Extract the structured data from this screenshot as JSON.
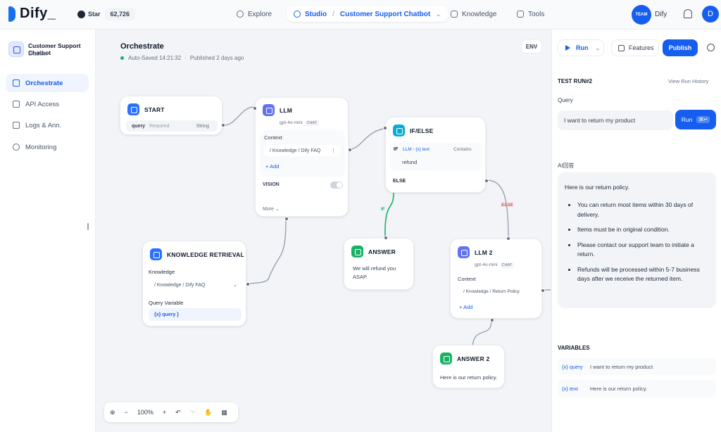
{
  "topbar": {
    "logo": "Dify_",
    "star_label": "Star",
    "star_count": "62,726",
    "nav": {
      "explore": "Explore",
      "studio": "Studio",
      "app_name": "Customer Support Chatbot",
      "knowledge": "Knowledge",
      "tools": "Tools"
    },
    "team_badge": "TEAM",
    "team_name": "Dify",
    "user_initial": "D"
  },
  "sidebar": {
    "app_name": "Customer Support Chatbot",
    "app_type": "Chatflow",
    "items": [
      {
        "label": "Orchestrate",
        "icon": "document-icon",
        "active": true
      },
      {
        "label": "API Access",
        "icon": "terminal-icon",
        "active": false
      },
      {
        "label": "Logs & Ann.",
        "icon": "logs-icon",
        "active": false
      },
      {
        "label": "Monitoring",
        "icon": "monitor-icon",
        "active": false
      }
    ]
  },
  "canvas": {
    "title": "Orchestrate",
    "autosave": "Auto-Saved 14:21:32",
    "separator": "·",
    "published": "Published 2 days ago",
    "env_label": "ENV",
    "nodes": {
      "start": {
        "title": "START",
        "var": "query",
        "required": "Required",
        "type": "String"
      },
      "llm": {
        "title": "LLM",
        "model": "gpt-4o-mini",
        "tag": "CHAT",
        "context_label": "Context",
        "context_value": "/ Knowledge / Dify FAQ",
        "add": "+ Add",
        "vision": "VISION",
        "more": "More"
      },
      "ifelse": {
        "title": "IF/ELSE",
        "if_label": "IF",
        "var_source": "LLM",
        "var_slash": "/",
        "var_name": "{x} text",
        "operator": "Contains",
        "value": "refund",
        "else_label": "ELSE"
      },
      "knowledge": {
        "title": "KNOWLEDGE RETRIEVAL",
        "knowledge_label": "Knowledge",
        "knowledge_value": "/ Knowledge / Dify FAQ",
        "query_var_label": "Query Variable",
        "query_var": "{x} query }"
      },
      "answer": {
        "title": "ANSWER",
        "text_line1": "We will refund you",
        "text_line2": "ASAP."
      },
      "llm2": {
        "title": "LLM 2",
        "model": "gpt-4o-mini",
        "tag": "CHAT",
        "context_label": "Context",
        "context_value": "/ Knowledge / Return Policy",
        "add": "+ Add"
      },
      "answer2": {
        "title": "ANSWER 2",
        "text": "Here is our return policy."
      }
    },
    "branch_if": "IF",
    "branch_else": "ELSE"
  },
  "zoom": {
    "level": "100%"
  },
  "run_panel": {
    "run_label": "Run",
    "features_label": "Features",
    "publish_label": "Publish",
    "test_run_title": "TEST RUN#2",
    "view_history": "View Run History",
    "query_label": "Query",
    "query_value": "I want to return my product",
    "run_button": "Run",
    "shortcut": "⌘↵",
    "answer_label": "AI回答",
    "answer_intro": "Here is our return policy.",
    "answer_points": [
      "You can return most items within 30 days of delivery.",
      "Items must be in original condition.",
      "Please contact our support team to initiate a return.",
      "Refunds will be processed within 5-7 business days after we receive the returned item."
    ],
    "variables_title": "VARIABLES",
    "variables": [
      {
        "name": "{x} query",
        "value": "I want to return my product"
      },
      {
        "name": "{x} text",
        "value": "Here is our return policy."
      }
    ]
  },
  "colors": {
    "accent": "#155eef",
    "start_icon": "#2970ff",
    "llm_icon": "#6172f3",
    "ifelse_icon": "#06aed4",
    "answer_icon": "#f79009",
    "knowledge_icon": "#16b364",
    "if_wire": "#16b364",
    "else_text": "#f04438"
  }
}
